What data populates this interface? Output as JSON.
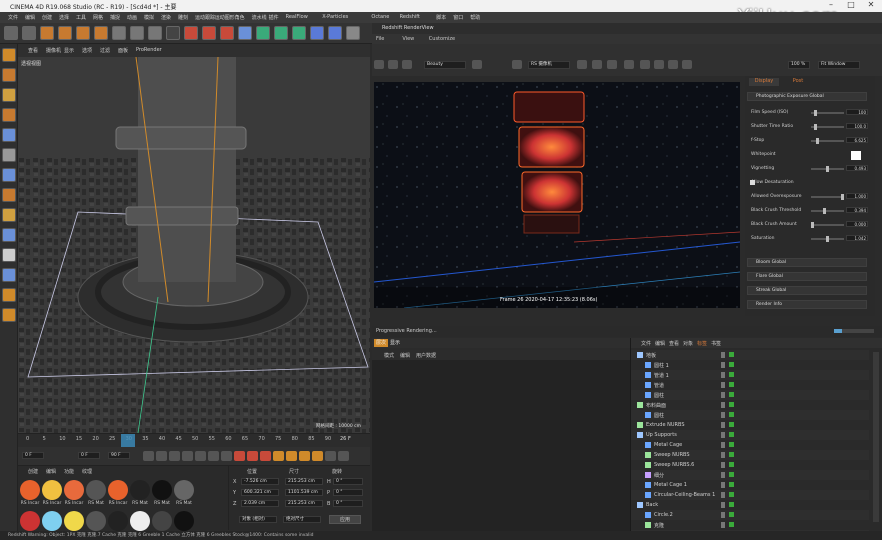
{
  "app_title": "CINEMA 4D R19.068 Studio (RC - R19) - [Scd4d *] - 主要",
  "watermark": "YiiHuu.com",
  "menu": [
    "文件",
    "编辑",
    "创建",
    "选择",
    "工具",
    "网格",
    "捕捉",
    "动画",
    "模拟",
    "渲染",
    "雕刻",
    "运动跟踪",
    "运动图形",
    "角色",
    "流水线",
    "插件",
    "RealFlow",
    "X-Particles",
    "Octane",
    "Redshift",
    "脚本",
    "窗口",
    "帮助"
  ],
  "viewport_menu": [
    "查看",
    "摄像机",
    "显示",
    "选项",
    "过滤",
    "面板",
    "ProRender"
  ],
  "viewport_label": "透视视图",
  "viewport_grid": "网格间距 : 10000 cm",
  "timeline_ticks": [
    "0",
    "5",
    "10",
    "15",
    "20",
    "25",
    "30",
    "35",
    "40",
    "45",
    "50",
    "55",
    "60",
    "65",
    "70",
    "75",
    "80",
    "85",
    "90"
  ],
  "timeline_end": "26 F",
  "play_fields": {
    "start": "0 F",
    "current": "0 F",
    "end": "90 F",
    "max": "90 F"
  },
  "mat_tabs": [
    "创建",
    "编辑",
    "功能",
    "纹理"
  ],
  "materials_row1": [
    {
      "label": "RS Incar",
      "color": "#e8622c"
    },
    {
      "label": "RS Incar",
      "color": "#f0c040"
    },
    {
      "label": "RS Incar",
      "color": "#e86a3c"
    },
    {
      "label": "RS Mat",
      "color": "#555555"
    },
    {
      "label": "RS Incar",
      "color": "#e8622c"
    },
    {
      "label": "RS Mat",
      "color": "#222222"
    },
    {
      "label": "RS Mat",
      "color": "#111111"
    },
    {
      "label": "RS Mat",
      "color": "#666666"
    }
  ],
  "materials_row2": [
    {
      "label": "",
      "color": "#cc3333"
    },
    {
      "label": "",
      "color": "#7fd0f0"
    },
    {
      "label": "",
      "color": "#f0d84a"
    },
    {
      "label": "",
      "color": "#555555"
    },
    {
      "label": "",
      "color": "#222222"
    },
    {
      "label": "",
      "color": "#eeeeee"
    },
    {
      "label": "",
      "color": "#444444"
    },
    {
      "label": "",
      "color": "#111111"
    }
  ],
  "coords": {
    "headers": [
      "位置",
      "尺寸",
      "旋转"
    ],
    "rows": [
      {
        "axis": "X",
        "pos": "-7.526 cm",
        "size": "215.253 cm",
        "rot_label": "H",
        "rot": "0 °"
      },
      {
        "axis": "Y",
        "pos": "600.321 cm",
        "size": "1101.539 cm",
        "rot_label": "P",
        "rot": "0 °"
      },
      {
        "axis": "Z",
        "pos": "2.039 cm",
        "size": "215.253 cm",
        "rot_label": "B",
        "rot": "0 °"
      }
    ],
    "mode_a": "对象 (相对)",
    "mode_b": "绝对尺寸",
    "apply": "应用"
  },
  "render_view": {
    "title": "Redshift RenderView",
    "menu": [
      "File",
      "View",
      "Customize"
    ],
    "preset": "Beauty",
    "camera": "RS 摄像机",
    "zoom": "100 %",
    "fit": "Fit Window",
    "frame_info": "Frame 26   2020-04-17  12:35:23  (8.06s)",
    "progress_text": "Progressive Rendering..."
  },
  "props": {
    "tabs": [
      "Display",
      "Post"
    ],
    "section_header": "Photographic Exposure  Global",
    "fields": [
      {
        "label": "Film Speed (ISO)",
        "value": "100",
        "pos": 0.1
      },
      {
        "label": "Shutter Time Ratio",
        "value": "100.0",
        "pos": 0.1
      },
      {
        "label": "f-Stop",
        "value": "6.625",
        "pos": 0.15
      },
      {
        "label": "Whitepoint",
        "value": "",
        "pos": -1
      },
      {
        "label": "Vignetting",
        "value": "0.493",
        "pos": 0.5
      },
      {
        "label": "Allow Desaturation",
        "value": "",
        "pos": -1
      },
      {
        "label": "Allowed Overexposure",
        "value": "1.000",
        "pos": 1.0
      },
      {
        "label": "Black Crush Threshold",
        "value": "0.394",
        "pos": 0.4
      },
      {
        "label": "Black Crush Amount",
        "value": "0.000",
        "pos": 0.0
      },
      {
        "label": "Saturation",
        "value": "1.042",
        "pos": 0.5
      }
    ],
    "sections": [
      "Bloom  Global",
      "Flare  Global",
      "Streak  Global",
      "Render Info"
    ]
  },
  "obj_tabs": [
    "层次",
    "显示"
  ],
  "obj_menu": [
    "模式",
    "编辑",
    "用户数据"
  ],
  "om_tabs": [
    "文件",
    "编辑",
    "查看",
    "对象",
    "标签",
    "书签"
  ],
  "objects": [
    {
      "name": "地板",
      "indent": 0,
      "icon": "#9ec7ff"
    },
    {
      "name": "圆柱 1",
      "indent": 1,
      "icon": "#6aa6ff"
    },
    {
      "name": "管道 1",
      "indent": 1,
      "icon": "#6aa6ff"
    },
    {
      "name": "管道",
      "indent": 1,
      "icon": "#6aa6ff"
    },
    {
      "name": "圆柱",
      "indent": 1,
      "icon": "#6aa6ff"
    },
    {
      "name": "布料曲面",
      "indent": 0,
      "icon": "#9be49b"
    },
    {
      "name": "圆柱",
      "indent": 1,
      "icon": "#6aa6ff"
    },
    {
      "name": "Extrude NURBS",
      "indent": 0,
      "icon": "#9be49b"
    },
    {
      "name": "Up Supports",
      "indent": 0,
      "icon": "#9ec7ff"
    },
    {
      "name": "Metal Cage",
      "indent": 1,
      "icon": "#6aa6ff"
    },
    {
      "name": "Sweep NURBS",
      "indent": 1,
      "icon": "#9be49b"
    },
    {
      "name": "Sweep NURBS.6",
      "indent": 1,
      "icon": "#9be49b"
    },
    {
      "name": "细分",
      "indent": 1,
      "icon": "#c7a0ff"
    },
    {
      "name": "Metal Cage 1",
      "indent": 1,
      "icon": "#6aa6ff"
    },
    {
      "name": "Circular-Ceiling-Beams 1",
      "indent": 1,
      "icon": "#6aa6ff"
    },
    {
      "name": "Back",
      "indent": 0,
      "icon": "#9ec7ff"
    },
    {
      "name": "Circle.2",
      "indent": 1,
      "icon": "#6aa6ff"
    },
    {
      "name": "克隆",
      "indent": 1,
      "icon": "#9be49b"
    },
    {
      "name": "Cube 1",
      "indent": 2,
      "icon": "#6aa6ff"
    }
  ],
  "status": "Redshift Warning: Object: 1PX 克隆 克隆.7 Cache 克隆 克隆 6 Greeble 1 Cache 立方体 克隆 6 Greebles Stock@1400: Contains some invalid"
}
